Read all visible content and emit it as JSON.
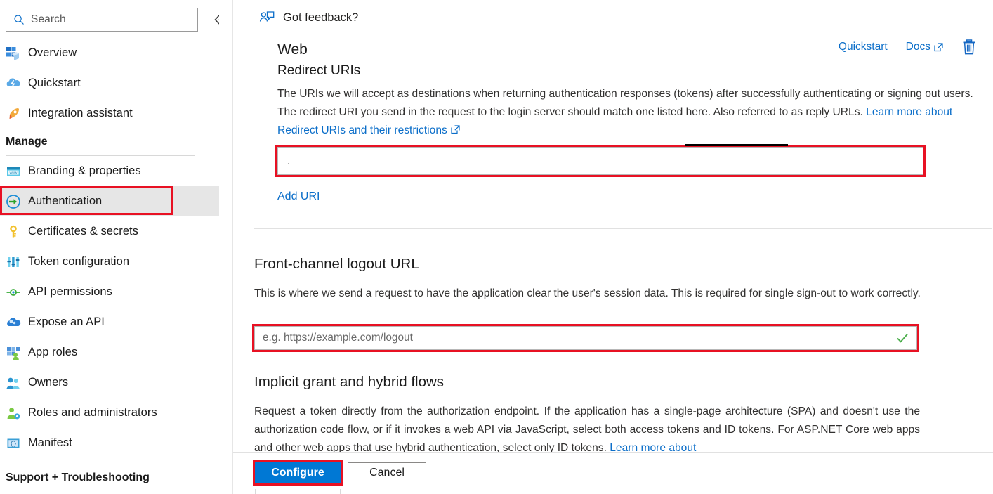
{
  "sidebar": {
    "search": {
      "placeholder": "Search",
      "icon": "search-icon"
    },
    "collapse_label": "«",
    "items": [
      {
        "label": "Overview",
        "icon": "overview-grid-icon"
      },
      {
        "label": "Quickstart",
        "icon": "cloud-lightning-icon"
      },
      {
        "label": "Integration assistant",
        "icon": "rocket-icon"
      }
    ],
    "group_manage": "Manage",
    "manage_items": [
      {
        "label": "Branding & properties",
        "icon": "browser-window-icon",
        "selected": false
      },
      {
        "label": "Authentication",
        "icon": "arrow-into-door-icon",
        "selected": true
      },
      {
        "label": "Certificates & secrets",
        "icon": "key-icon",
        "selected": false
      },
      {
        "label": "Token configuration",
        "icon": "bar-sliders-icon",
        "selected": false
      },
      {
        "label": "API permissions",
        "icon": "plug-connector-icon",
        "selected": false
      },
      {
        "label": "Expose an API",
        "icon": "cloud-gear-icon",
        "selected": false
      },
      {
        "label": "App roles",
        "icon": "grid-person-icon",
        "selected": false
      },
      {
        "label": "Owners",
        "icon": "two-people-icon",
        "selected": false
      },
      {
        "label": "Roles and administrators",
        "icon": "person-gear-icon",
        "selected": false
      },
      {
        "label": "Manifest",
        "icon": "braces-icon",
        "selected": false
      }
    ],
    "group_support": "Support + Troubleshooting"
  },
  "header": {
    "feedback_label": "Got feedback?",
    "feedback_icon": "person-speech-icon"
  },
  "card": {
    "title": "Web",
    "subtitle": "Redirect URIs",
    "description_part1": "The URIs we will accept as destinations when returning authentication responses (tokens) after successfully authenticating or signing out users. The redirect URI you send in the request to the login server should match one listed here. Also referred to as reply URLs. ",
    "description_link": "Learn more about Redirect URIs and their restrictions",
    "actions": {
      "quickstart": "Quickstart",
      "docs": "Docs",
      "delete_icon": "trash-icon"
    },
    "uri_value": ".",
    "uri_delete_icon": "trash-icon",
    "add_uri_label": "Add URI"
  },
  "logout_section": {
    "title": "Front-channel logout URL",
    "description": "This is where we send a request to have the application clear the user's session data. This is required for single sign-out to work correctly.",
    "placeholder": "e.g. https://example.com/logout",
    "value": "",
    "valid_icon": "green-check-icon"
  },
  "implicit_section": {
    "title": "Implicit grant and hybrid flows",
    "description_line1": "Request a token directly from the authorization endpoint. If the application has a single-page architecture (SPA) and",
    "description_line2": "doesn't use the authorization code flow, or if it invokes a web API via JavaScript, select both access tokens and ID tokens.",
    "description_line3": "For ASP.NET Core web apps and other web apps that use hybrid authentication, select only ID tokens. ",
    "description_link": "Learn more about"
  },
  "footer": {
    "configure_label": "Configure",
    "cancel_label": "Cancel"
  },
  "colors": {
    "accent_blue": "#0078d4",
    "link_blue": "#0b6ec9",
    "highlight_red": "#e81123",
    "valid_green": "#4cae4c",
    "selected_bg": "#e6e6e6"
  }
}
